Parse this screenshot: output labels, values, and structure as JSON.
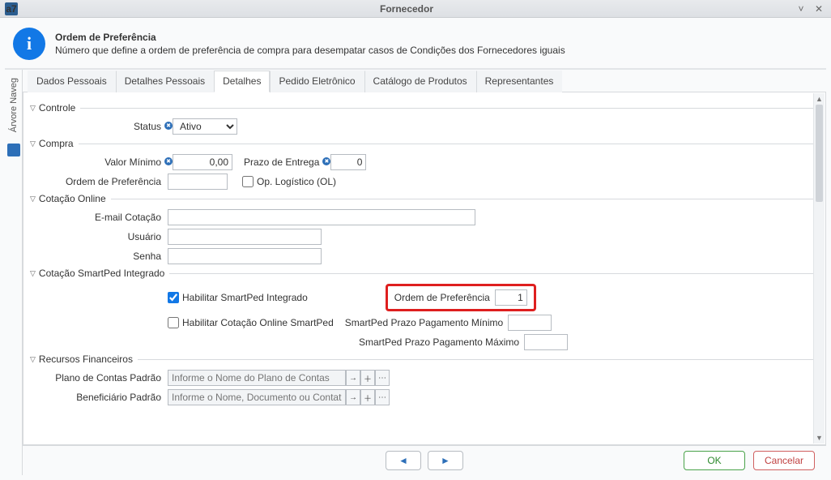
{
  "app_icon_label": "a7",
  "window_title": "Fornecedor",
  "header": {
    "title": "Ordem de Preferência",
    "subtitle": "Número que define a ordem de preferência de compra para desempatar casos de Condições dos Fornecedores iguais"
  },
  "side_rail": {
    "label": "Árvore Naveg"
  },
  "tabs": [
    "Dados Pessoais",
    "Detalhes Pessoais",
    "Detalhes",
    "Pedido Eletrônico",
    "Catálogo de Produtos",
    "Representantes"
  ],
  "active_tab_index": 2,
  "groups": {
    "controle": {
      "title": "Controle",
      "status_label": "Status",
      "status_value": "Ativo"
    },
    "compra": {
      "title": "Compra",
      "valor_minimo_label": "Valor Mínimo",
      "valor_minimo_value": "0,00",
      "prazo_entrega_label": "Prazo de Entrega",
      "prazo_entrega_value": "0",
      "ordem_pref_label": "Ordem de Preferência",
      "ordem_pref_value": "",
      "op_logistico_label": "Op. Logístico (OL)"
    },
    "cot_online": {
      "title": "Cotação Online",
      "email_label": "E-mail Cotação",
      "usuario_label": "Usuário",
      "senha_label": "Senha"
    },
    "smartped": {
      "title": "Cotação SmartPed Integrado",
      "hab_smartped_label": "Habilitar SmartPed Integrado",
      "hab_smartped_checked": true,
      "hab_cot_online_label": "Habilitar Cotação Online SmartPed",
      "hab_cot_online_checked": false,
      "ordem_pref_label": "Ordem de Preferência",
      "ordem_pref_value": "1",
      "prazo_min_label": "SmartPed Prazo Pagamento Mínimo",
      "prazo_min_value": "",
      "prazo_max_label": "SmartPed Prazo Pagamento Máximo",
      "prazo_max_value": ""
    },
    "recursos": {
      "title": "Recursos Financeiros",
      "plano_label": "Plano de Contas Padrão",
      "plano_placeholder": "Informe o Nome do Plano de Contas",
      "benef_label": "Beneficiário Padrão",
      "benef_placeholder": "Informe o Nome, Documento ou Contato"
    }
  },
  "footer": {
    "ok": "OK",
    "cancel": "Cancelar"
  }
}
